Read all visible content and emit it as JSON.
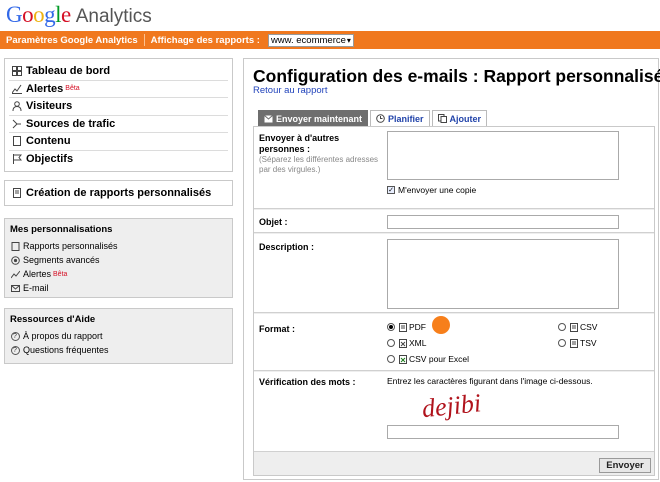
{
  "header": {
    "logo_parts": [
      "G",
      "o",
      "o",
      "g",
      "l",
      "e"
    ],
    "product": "Analytics"
  },
  "topbar": {
    "settings_label": "Paramètres Google Analytics",
    "view_reports_label": "Affichage des rapports :",
    "profile_value": "www. ecommerce"
  },
  "sidebar": {
    "nav_items": [
      {
        "label": "Tableau de bord",
        "icon": "dashboard-icon"
      },
      {
        "label": "Alertes",
        "icon": "alerts-icon",
        "badge": "Bêta"
      },
      {
        "label": "Visiteurs",
        "icon": "person-icon"
      },
      {
        "label": "Sources de trafic",
        "icon": "traffic-sources-icon"
      },
      {
        "label": "Contenu",
        "icon": "content-icon"
      },
      {
        "label": "Objectifs",
        "icon": "flag-icon"
      }
    ],
    "custom_reports": "Création de rapports personnalisés",
    "personalisations": {
      "title": "Mes personnalisations",
      "items": [
        {
          "label": "Rapports personnalisés"
        },
        {
          "label": "Segments avancés"
        },
        {
          "label": "Alertes",
          "badge": "Bêta"
        },
        {
          "label": "E-mail"
        }
      ]
    },
    "help": {
      "title": "Ressources d'Aide",
      "items": [
        {
          "label": "À propos du rapport"
        },
        {
          "label": "Questions fréquentes"
        }
      ]
    }
  },
  "main": {
    "title": "Configuration des e-mails : Rapport personnalisé",
    "back_link": "Retour au rapport",
    "tabs": [
      "Envoyer maintenant",
      "Planifier",
      "Ajouter"
    ],
    "form": {
      "recipients_label": "Envoyer à d'autres personnes :",
      "recipients_hint": "(Séparez les différentes adresses par des virgules.)",
      "recipients_value": "",
      "send_copy_label": "M'envoyer une copie",
      "send_copy_checked": true,
      "subject_label": "Objet :",
      "subject_value": "",
      "description_label": "Description :",
      "description_value": "",
      "format_label": "Format :",
      "formats": [
        {
          "label": "PDF",
          "selected": true
        },
        {
          "label": "CSV",
          "selected": false
        },
        {
          "label": "XML",
          "selected": false
        },
        {
          "label": "TSV",
          "selected": false
        },
        {
          "label": "CSV pour Excel",
          "selected": false
        }
      ],
      "captcha_label": "Vérification des mots :",
      "captcha_instruction": "Entrez les caractères figurant dans l'image ci-dessous.",
      "captcha_word": "dejibi",
      "captcha_value": "",
      "send_button": "Envoyer"
    }
  },
  "colors": {
    "accent_orange": "#f0781e",
    "marker_orange": "#f77f1b",
    "captcha_red": "#b0121b"
  }
}
